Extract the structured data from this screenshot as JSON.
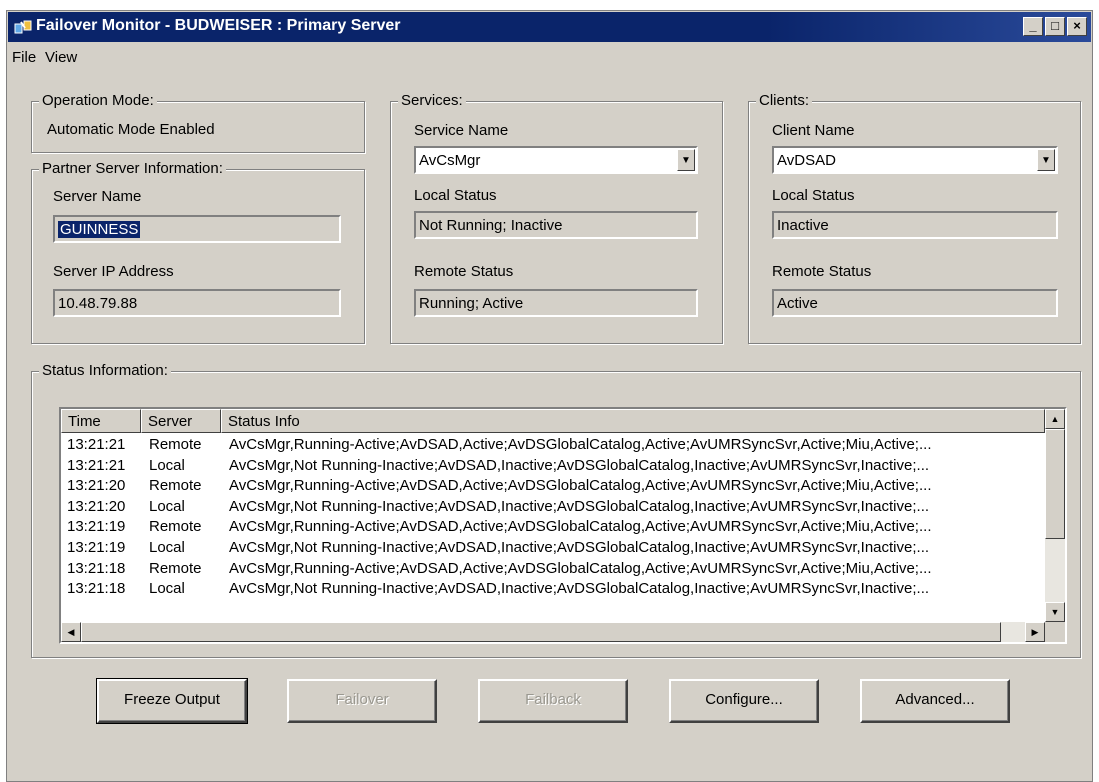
{
  "window": {
    "title": "Failover Monitor - BUDWEISER : Primary Server"
  },
  "menu": {
    "file": "File",
    "view": "View"
  },
  "operation_mode": {
    "legend": "Operation Mode:",
    "value": "Automatic Mode Enabled"
  },
  "partner": {
    "legend": "Partner Server Information:",
    "server_name_label": "Server Name",
    "server_name": "GUINNESS",
    "server_ip_label": "Server IP Address",
    "server_ip": "10.48.79.88"
  },
  "services": {
    "legend": "Services:",
    "name_label": "Service Name",
    "selected": "AvCsMgr",
    "local_status_label": "Local Status",
    "local_status": "Not Running; Inactive",
    "remote_status_label": "Remote Status",
    "remote_status": "Running; Active"
  },
  "clients": {
    "legend": "Clients:",
    "name_label": "Client Name",
    "selected": "AvDSAD",
    "local_status_label": "Local Status",
    "local_status": "Inactive",
    "remote_status_label": "Remote Status",
    "remote_status": "Active"
  },
  "status": {
    "legend": "Status Information:",
    "columns": [
      "Time",
      "Server",
      "Status Info"
    ],
    "rows": [
      {
        "time": "13:21:21",
        "server": "Remote",
        "info": "AvCsMgr,Running-Active;AvDSAD,Active;AvDSGlobalCatalog,Active;AvUMRSyncSvr,Active;Miu,Active;..."
      },
      {
        "time": "13:21:21",
        "server": "Local",
        "info": "AvCsMgr,Not Running-Inactive;AvDSAD,Inactive;AvDSGlobalCatalog,Inactive;AvUMRSyncSvr,Inactive;..."
      },
      {
        "time": "13:21:20",
        "server": "Remote",
        "info": "AvCsMgr,Running-Active;AvDSAD,Active;AvDSGlobalCatalog,Active;AvUMRSyncSvr,Active;Miu,Active;..."
      },
      {
        "time": "13:21:20",
        "server": "Local",
        "info": "AvCsMgr,Not Running-Inactive;AvDSAD,Inactive;AvDSGlobalCatalog,Inactive;AvUMRSyncSvr,Inactive;..."
      },
      {
        "time": "13:21:19",
        "server": "Remote",
        "info": "AvCsMgr,Running-Active;AvDSAD,Active;AvDSGlobalCatalog,Active;AvUMRSyncSvr,Active;Miu,Active;..."
      },
      {
        "time": "13:21:19",
        "server": "Local",
        "info": "AvCsMgr,Not Running-Inactive;AvDSAD,Inactive;AvDSGlobalCatalog,Inactive;AvUMRSyncSvr,Inactive;..."
      },
      {
        "time": "13:21:18",
        "server": "Remote",
        "info": "AvCsMgr,Running-Active;AvDSAD,Active;AvDSGlobalCatalog,Active;AvUMRSyncSvr,Active;Miu,Active;..."
      },
      {
        "time": "13:21:18",
        "server": "Local",
        "info": "AvCsMgr,Not Running-Inactive;AvDSAD,Inactive;AvDSGlobalCatalog,Inactive;AvUMRSyncSvr,Inactive;..."
      }
    ]
  },
  "buttons": {
    "freeze": "Freeze Output",
    "failover": "Failover",
    "failback": "Failback",
    "configure": "Configure...",
    "advanced": "Advanced..."
  },
  "colors": {
    "title_bar": "#0a246a",
    "face": "#d4d0c8",
    "selection": "#0a246a"
  }
}
